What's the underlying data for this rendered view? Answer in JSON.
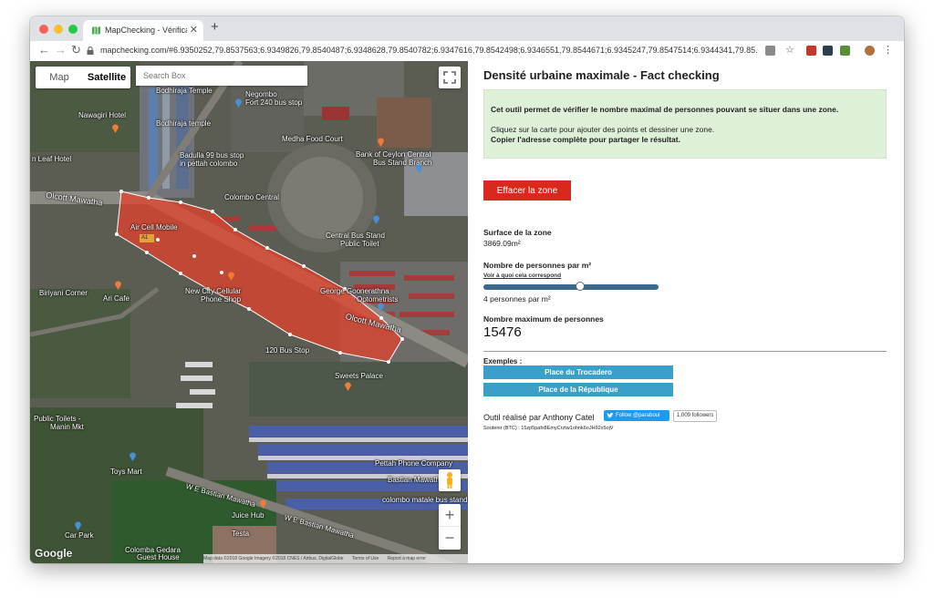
{
  "browser": {
    "tab_title": "MapChecking - Vérificateur de",
    "url": "mapchecking.com/#6.9350252,79.8537563;6.9349826,79.8540487;6.9348628,79.8540782;6.9347616,79.8542498;6.9346551,79.8544671;6.9345247,79.8547514;6.9344341,79.85...",
    "nav_icons": [
      "back-icon",
      "forward-icon",
      "reload-icon"
    ]
  },
  "map": {
    "type_map": "Map",
    "type_satellite": "Satellite",
    "search_placeholder": "Search Box",
    "google": "Google",
    "attribution": [
      "Map data ©2018 Google Imagery ©2018 CNES / Airbus, DigitalGlobe",
      "Terms of Use",
      "Report a map error"
    ],
    "zoom_in": "+",
    "zoom_out": "−",
    "road_tag": "A1",
    "labels": {
      "bodhiraja1": "Bodhiraja Temple",
      "negombo": "Negombo",
      "fort240": "Fort 240 bus stop",
      "nawagiri": "Nawagiri Hotel",
      "bodhiraja2": "Bodhiraja temple",
      "medha": "Medha Food Court",
      "badulla1": "Badulla 99 bus stop",
      "badulla2": "in pettah colombo",
      "boc1": "Bank of Ceylon Central",
      "boc2": "Bus Stand Branch",
      "leaf": "n Leaf Hotel",
      "olcott1": "Olcott Mawatha",
      "colombo_central": "Colombo Central",
      "aircell": "Air Cell Mobile",
      "central1": "Central Bus Stand",
      "central2": "Public Toilet",
      "biriyani": "Biriyani Corner",
      "ari": "Ari Cafe",
      "newcity1": "New City Cellular",
      "newcity2": "Phone Shop",
      "george1": "George Goonerathna",
      "george2": "Optometrists",
      "olcott2": "Olcott Mawatha",
      "busstop120": "120 Bus Stop",
      "sweets": "Sweets Palace",
      "toilets1": "Public Toilets -",
      "toilets2": "Manin Mkt",
      "pettah": "Pettah Phone Company",
      "toys": "Toys Mart",
      "bastian": "Bastian Mawatha",
      "wbastian1": "W E Bastian Mawatha",
      "wbastian2": "W E Bastian Mawatha",
      "matale": "colombo matale bus stand",
      "juice": "Juice Hub",
      "testa": "Testa",
      "carpark": "Car Park",
      "gedara1": "Colomba Gedara",
      "gedara2": "Guest House"
    }
  },
  "panel": {
    "title": "Densité urbaine maximale - Fact checking",
    "info_line1": "Cet outil permet de vérifier le nombre maximal de personnes pouvant se situer dans une zone.",
    "info_line2": "Cliquez sur la carte pour ajouter des points et dessiner une zone.",
    "info_line3": "Copier l'adresse complète pour partager le résultat.",
    "clear_button": "Effacer la zone",
    "surface_label": "Surface de la zone",
    "surface_value": "3869.09m²",
    "density_label": "Nombre de personnes par m²",
    "density_link": "Voir à quoi cela correspond",
    "density_value": "4 personnes par m²",
    "density_slider_fraction": 0.55,
    "max_label": "Nombre maximum de personnes",
    "max_value": "15476",
    "examples_label": "Exemples :",
    "example1": "Place du Trocadero",
    "example2": "Place de la République",
    "credit": "Outil réalisé par Anthony Catel",
    "twitter_follow": "Follow @paraboul",
    "followers": "1,009 followers",
    "btc": "Soutenir (BTC) : 15zp5pafx8EmyCrztw1ohnk6oJH92x5ojV"
  },
  "colors": {
    "polygon_fill": "#e8402a",
    "clear_button": "#d9281e",
    "example_button": "#3a9fc9",
    "info_bg": "#dff0d8",
    "slider": "#3b6a8a"
  }
}
